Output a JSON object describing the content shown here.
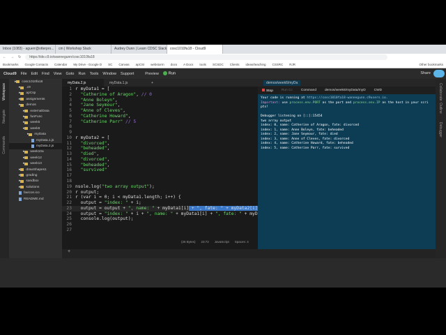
{
  "browser": {
    "tabs": [
      "Inbox (1083) - aguerr@otterpro...",
      "cm | Workshop Slack",
      "Audrey Dunn | Learn CDSC Slack",
      "cosc1010fa18 - Cloud9"
    ],
    "url": "https://ide.c9.io/wannegunn/cosc1010fa18",
    "bookmarks": [
      "Bookmarks",
      "Google Contacts",
      "Calendar",
      "My Drive - Google D",
      "SC",
      "Canvas",
      "apCSI",
      "webstorm",
      "docs",
      "A Docs",
      "tools",
      "SCSDC",
      "Clients",
      "ideas/teaching",
      "CSSRC",
      "RJR",
      "Other bookmarks"
    ]
  },
  "menubar": {
    "items": [
      "Cloud9",
      "File",
      "Edit",
      "Find",
      "View",
      "Goto",
      "Run",
      "Tools",
      "Window",
      "Support"
    ],
    "preview": "Preview",
    "run": "Run",
    "share": "Share"
  },
  "sidebar": {
    "panels": [
      "Workspace",
      "Navigate",
      "Commands"
    ],
    "tree": [
      {
        "label": "cosc1010fa18",
        "type": "folder",
        "depth": 0
      },
      {
        "label": ".c9",
        "type": "folder",
        "depth": 1
      },
      {
        "label": "apCsp",
        "type": "folder",
        "depth": 1
      },
      {
        "label": "assignments",
        "type": "folder",
        "depth": 1
      },
      {
        "label": "demos",
        "type": "folder",
        "depth": 1
      },
      {
        "label": "externalData",
        "type": "folder",
        "depth": 2
      },
      {
        "label": "funFunc",
        "type": "folder",
        "depth": 2
      },
      {
        "label": "week5",
        "type": "folder",
        "depth": 2
      },
      {
        "label": "week6",
        "type": "folder",
        "depth": 2
      },
      {
        "label": "myData",
        "type": "folder",
        "depth": 3
      },
      {
        "label": "myData.1.js",
        "type": "file",
        "depth": 4
      },
      {
        "label": "myData.2.js",
        "type": "file",
        "depth": 4,
        "selected": true
      },
      {
        "label": "week10a",
        "type": "folder",
        "depth": 2
      },
      {
        "label": "week12",
        "type": "folder",
        "depth": 2
      },
      {
        "label": "week13",
        "type": "folder",
        "depth": 2
      },
      {
        "label": "drawShapes1",
        "type": "folder",
        "depth": 1
      },
      {
        "label": "grading",
        "type": "folder",
        "depth": 1
      },
      {
        "label": "sandbox",
        "type": "folder",
        "depth": 1
      },
      {
        "label": "solutions",
        "type": "folder",
        "depth": 1
      },
      {
        "label": "favicon.ico",
        "type": "file",
        "depth": 1
      },
      {
        "label": "README.md",
        "type": "file",
        "depth": 1
      }
    ]
  },
  "editor": {
    "tabs": [
      "myData.2.js",
      "myData.1.js"
    ],
    "lines": [
      [
        [
          "k",
          "r myData1 = ["
        ]
      ],
      [
        [
          "s",
          "  \"Catherine of Aragon\""
        ],
        [
          "k",
          ", "
        ],
        [
          "c",
          "// 0"
        ]
      ],
      [
        [
          "s",
          "  \"Anne Boleyn\""
        ],
        [
          "k",
          ","
        ]
      ],
      [
        [
          "s",
          "  \"Jane Seymour\""
        ],
        [
          "k",
          ","
        ]
      ],
      [
        [
          "s",
          "  \"Anne of Cleves\""
        ],
        [
          "k",
          ","
        ]
      ],
      [
        [
          "s",
          "  \"Catherine Howard\""
        ],
        [
          "k",
          ","
        ]
      ],
      [
        [
          "s",
          "  \"Catherine Parr\""
        ],
        [
          "k",
          " "
        ],
        [
          "c",
          "// 5"
        ]
      ],
      [],
      [],
      [
        [
          "k",
          "r myData2 = ["
        ]
      ],
      [
        [
          "s",
          "  \"divorced\""
        ],
        [
          "k",
          ","
        ]
      ],
      [
        [
          "s",
          "  \"beheaded\""
        ],
        [
          "k",
          ","
        ]
      ],
      [
        [
          "s",
          "  \"died\""
        ],
        [
          "k",
          ","
        ]
      ],
      [
        [
          "s",
          "  \"divorced\""
        ],
        [
          "k",
          ","
        ]
      ],
      [
        [
          "s",
          "  \"beheaded\""
        ],
        [
          "k",
          ","
        ]
      ],
      [
        [
          "s",
          "  \"survived\""
        ]
      ],
      [],
      [],
      [
        [
          "k",
          "nsole.log("
        ],
        [
          "s",
          "\"two array output\""
        ],
        [
          "k",
          ");"
        ]
      ],
      [
        [
          "k",
          "r output;"
        ]
      ],
      [
        [
          "k",
          "r (var i = 0; i < myData1.length; i++) {"
        ]
      ],
      [
        [
          "k",
          "  output = "
        ],
        [
          "s",
          "\"index: \""
        ],
        [
          "k",
          " + i;"
        ]
      ],
      [
        [
          "k",
          "  output = output + "
        ],
        [
          "s",
          "\", name: \""
        ],
        [
          "k",
          " + myData1[i]"
        ],
        [
          "hl",
          " + \", fate: \" + myData2[i]"
        ]
      ],
      [
        [
          "k",
          "  output = "
        ],
        [
          "s",
          "\"index: \""
        ],
        [
          "k",
          " + i + "
        ],
        [
          "s",
          "\", name: \""
        ],
        [
          "k",
          " + myData1[i] + "
        ],
        [
          "s",
          "\", fate: \""
        ],
        [
          "k",
          " + myDa"
        ]
      ],
      [
        [
          "k",
          "  console.log(output);"
        ]
      ],
      [],
      []
    ],
    "current_line": 23,
    "status": {
      "size": "(26 Bytes)",
      "position": "23:72",
      "language": "JavaScript",
      "spaces": "Spaces: 4"
    }
  },
  "terminal": {
    "tab": "demos/week6/myDa",
    "toolbar": {
      "stop": "Stop",
      "runcc": "Run Cc",
      "command": "Command",
      "path": "demos/week6/myData/myD",
      "cwd": "CWD"
    },
    "lines": [
      [
        [
          "n",
          "Your code is running at "
        ],
        [
          "u",
          "https://cosc1010fa18-wannegunn.c9users.io."
        ]
      ],
      [
        [
          "imp",
          "Important:"
        ],
        [
          "n",
          " use "
        ],
        [
          "g",
          "process.env.PORT"
        ],
        [
          "n",
          " as the port and "
        ],
        [
          "g",
          "process.env.IP"
        ],
        [
          "n",
          " as the host in your scri"
        ]
      ],
      [
        [
          "n",
          "pts!"
        ]
      ],
      [],
      [
        [
          "n",
          "Debugger listening on [::]:15454"
        ]
      ],
      [
        [
          "n",
          "two array output"
        ]
      ],
      [
        [
          "n",
          "index: 0, name: Catherine of Aragon, fate: divorced"
        ]
      ],
      [
        [
          "n",
          "index: 1, name: Anne Boleyn, fate: beheaded"
        ]
      ],
      [
        [
          "n",
          "index: 2, name: Jane Seymour, fate: died"
        ]
      ],
      [
        [
          "n",
          "index: 3, name: Anne of Cleves, fate: divorced"
        ]
      ],
      [
        [
          "n",
          "index: 4, name: Catherine Howard, fate: beheaded"
        ]
      ],
      [
        [
          "n",
          "index: 5, name: Catherine Parr, fate: survived"
        ]
      ]
    ]
  },
  "right_panels": [
    "Collaborate",
    "Outline",
    "Debugger"
  ],
  "colors": {
    "terminal_bg": "#0c3d55",
    "string": "#6fd86f",
    "comment": "#9a6fd8",
    "selection": "#3c78c8"
  }
}
